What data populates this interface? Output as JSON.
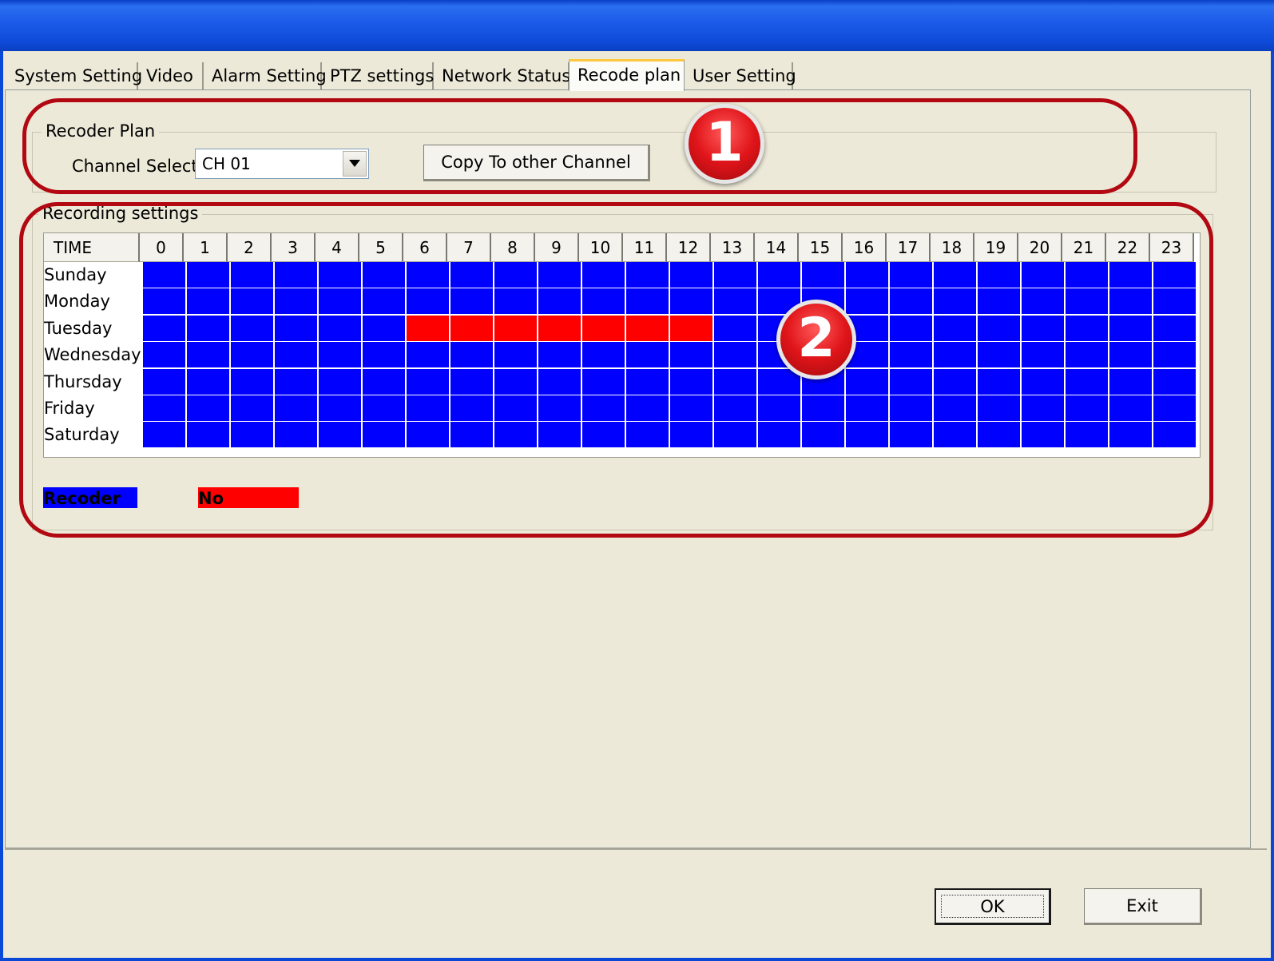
{
  "tabs": [
    {
      "label": "System Setting"
    },
    {
      "label": "Video"
    },
    {
      "label": "Alarm Setting"
    },
    {
      "label": "PTZ settings"
    },
    {
      "label": "Network Status"
    },
    {
      "label": "Recode plan"
    },
    {
      "label": "User Setting"
    }
  ],
  "active_tab": "Recode plan",
  "recoder_plan": {
    "group_title": "Recoder Plan",
    "channel_label": "Channel Select",
    "channel_value": "CH 01",
    "copy_button": "Copy To other Channel"
  },
  "recording_settings": {
    "group_title": "Recording settings",
    "time_header": "TIME",
    "hours": [
      "0",
      "1",
      "2",
      "3",
      "4",
      "5",
      "6",
      "7",
      "8",
      "9",
      "10",
      "11",
      "12",
      "13",
      "14",
      "15",
      "16",
      "17",
      "18",
      "19",
      "20",
      "21",
      "22",
      "23"
    ],
    "days": [
      "Sunday",
      "Monday",
      "Tuesday",
      "Wednesday",
      "Thursday",
      "Friday",
      "Saturday"
    ],
    "no_record_slots": [
      {
        "day": "Tuesday",
        "hours": [
          6,
          7,
          8,
          9,
          10,
          11,
          12
        ]
      }
    ],
    "legend": [
      {
        "label": "Recoder",
        "color": "#0000ff"
      },
      {
        "label": "No",
        "color": "#ff0000"
      }
    ]
  },
  "annotations": [
    "1",
    "2"
  ],
  "footer": {
    "ok_label": "OK",
    "exit_label": "Exit"
  },
  "colors": {
    "record": "#0000ff",
    "no_record": "#ff0000",
    "annotation": "#b20812",
    "title_bar": "#0a49d8"
  }
}
